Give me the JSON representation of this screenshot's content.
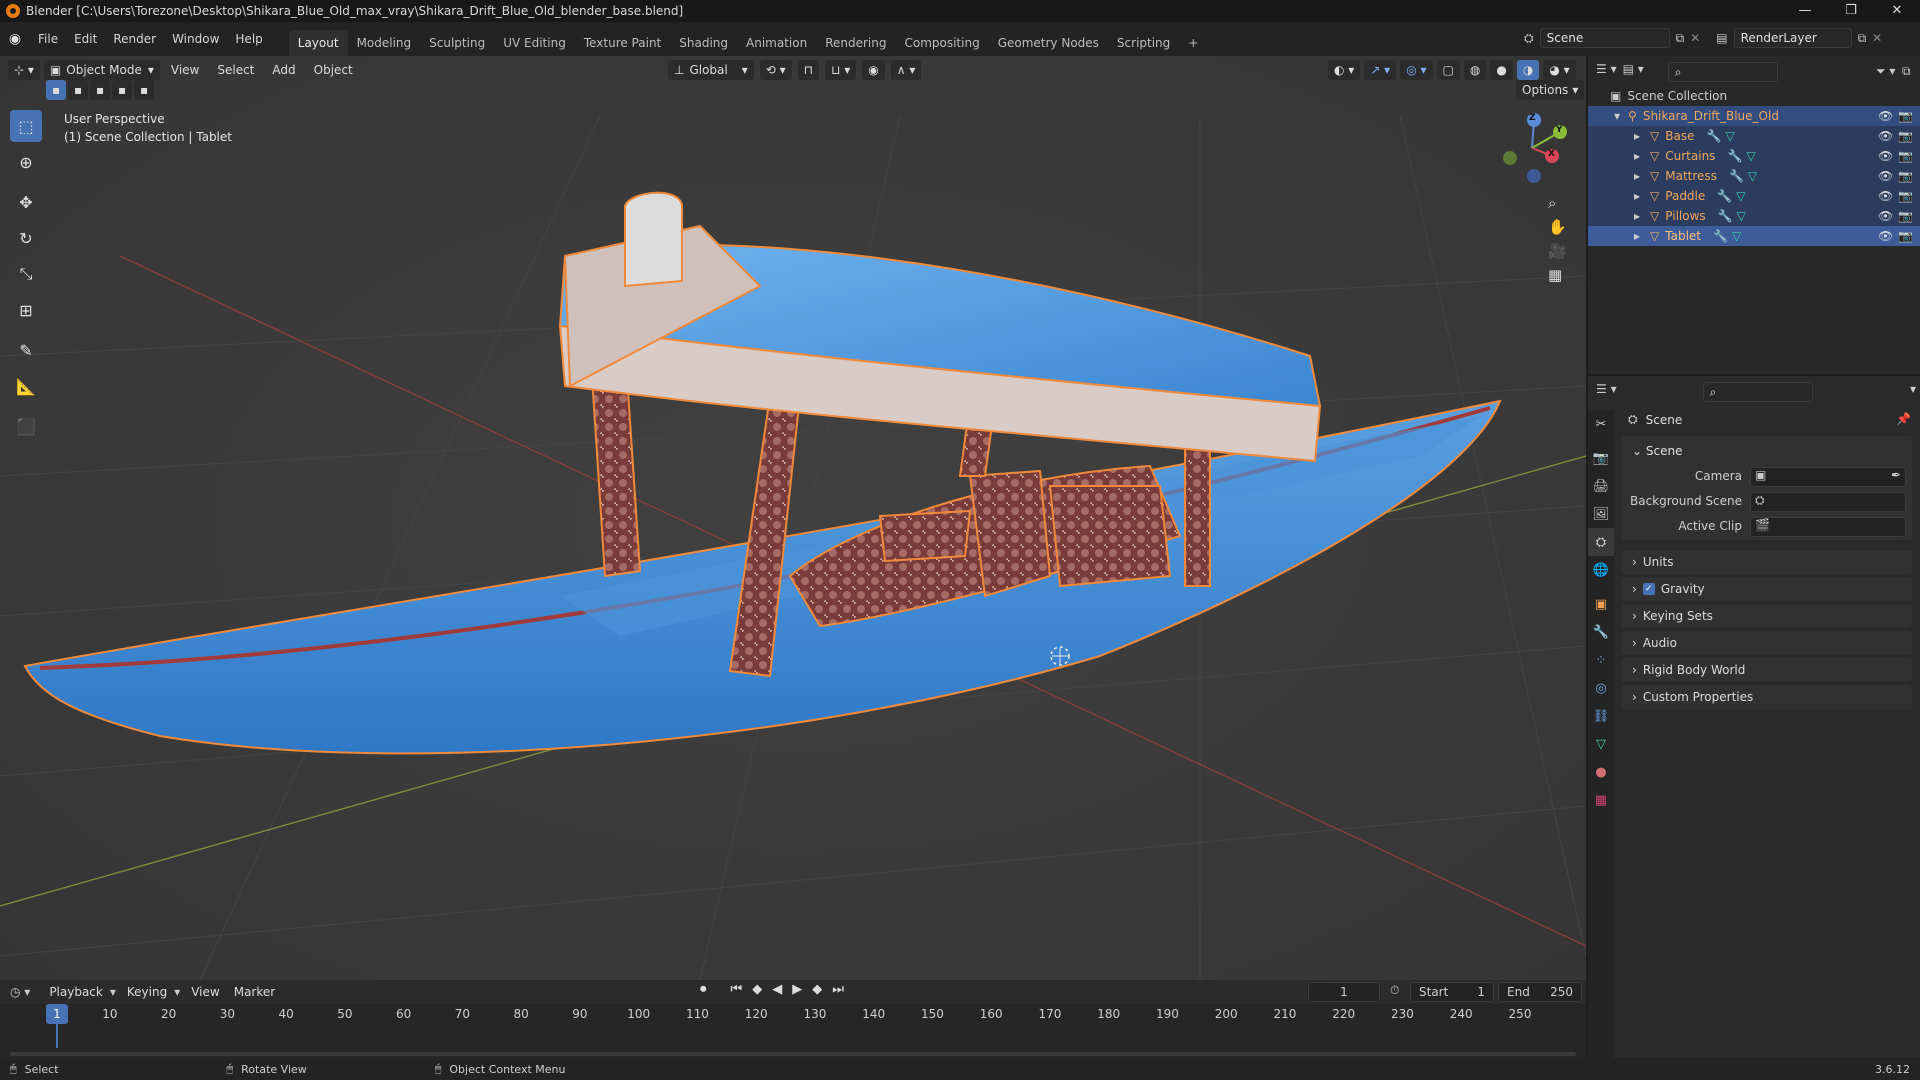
{
  "window": {
    "title": "Blender [C:\\Users\\Torezone\\Desktop\\Shikara_Blue_Old_max_vray\\Shikara_Drift_Blue_Old_blender_base.blend]",
    "minimize": "—",
    "maximize": "❐",
    "close": "✕"
  },
  "menu": {
    "items": [
      "File",
      "Edit",
      "Render",
      "Window",
      "Help"
    ],
    "workspaces": [
      "Layout",
      "Modeling",
      "Sculpting",
      "UV Editing",
      "Texture Paint",
      "Shading",
      "Animation",
      "Rendering",
      "Compositing",
      "Geometry Nodes",
      "Scripting"
    ],
    "add_workspace": "+",
    "scene": "Scene",
    "view_layer": "RenderLayer"
  },
  "viewport": {
    "mode": "Object Mode",
    "menus": [
      "View",
      "Select",
      "Add",
      "Object"
    ],
    "orientation": "Global",
    "options": "Options",
    "perspective": "User Perspective",
    "collection_info": "(1) Scene Collection | Tablet",
    "gizmo": {
      "x": "X",
      "y": "Y",
      "z": "Z"
    }
  },
  "outliner": {
    "root": "Scene Collection",
    "collection": "Shikara_Drift_Blue_Old",
    "objects": [
      "Base",
      "Curtains",
      "Mattress",
      "Paddle",
      "Pillows",
      "Tablet"
    ]
  },
  "properties": {
    "header": "Scene",
    "section": "Scene",
    "fields": [
      {
        "label": "Camera"
      },
      {
        "label": "Background Scene"
      },
      {
        "label": "Active Clip"
      }
    ],
    "panels": [
      "Units",
      "Gravity",
      "Keying Sets",
      "Audio",
      "Rigid Body World",
      "Custom Properties"
    ]
  },
  "timeline": {
    "menus": [
      "Playback",
      "Keying",
      "View",
      "Marker"
    ],
    "current_frame": "1",
    "start_label": "Start",
    "start": "1",
    "end_label": "End",
    "end": "250",
    "ticks": [
      "1",
      "10",
      "20",
      "30",
      "40",
      "50",
      "60",
      "70",
      "80",
      "90",
      "100",
      "110",
      "120",
      "130",
      "140",
      "150",
      "160",
      "170",
      "180",
      "190",
      "200",
      "210",
      "220",
      "230",
      "240",
      "250"
    ]
  },
  "status": {
    "select": "Select",
    "rotate": "Rotate View",
    "context": "Object Context Menu",
    "version": "3.6.12"
  },
  "colors": {
    "accent": "#4772b3",
    "object_orange": "#f0a75a",
    "boat_blue": "#3d8ad6"
  }
}
